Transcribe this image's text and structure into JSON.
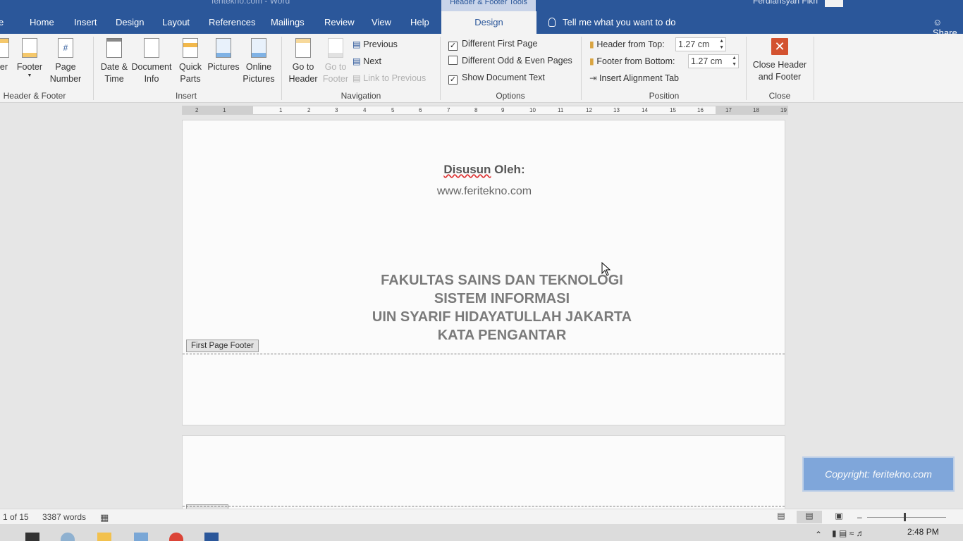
{
  "titlebar": {
    "doc_title": "feritekno.com  -  Word",
    "context_label": "Header & Footer Tools",
    "user": "Ferdiansyah Fikri",
    "tabs": [
      "Home",
      "Insert",
      "Design",
      "Layout",
      "References",
      "Mailings",
      "Review",
      "View",
      "Help"
    ],
    "active_tab": "Design",
    "tell_me": "Tell me what you want to do",
    "share": "Share"
  },
  "ribbon": {
    "header_footer": {
      "label": "Header & Footer",
      "header": "Header",
      "footer": "Footer",
      "page_number": "Page Number"
    },
    "insert": {
      "label": "Insert",
      "date_time": "Date & Time",
      "document_info": "Document Info",
      "quick_parts": "Quick Parts",
      "pictures": "Pictures",
      "online_pictures": "Online Pictures"
    },
    "navigation": {
      "label": "Navigation",
      "go_to_header": "Go to Header",
      "go_to_footer": "Go to Footer",
      "previous": "Previous",
      "next": "Next",
      "link_to_previous": "Link to Previous"
    },
    "options": {
      "label": "Options",
      "different_first_page": "Different First Page",
      "different_first_page_checked": true,
      "different_odd_even": "Different Odd & Even Pages",
      "different_odd_even_checked": false,
      "show_document_text": "Show Document Text",
      "show_document_text_checked": true
    },
    "position": {
      "label": "Position",
      "header_from_top": "Header from Top:",
      "header_from_top_value": "1.27 cm",
      "footer_from_bottom": "Footer from Bottom:",
      "footer_from_bottom_value": "1.27 cm",
      "insert_alignment_tab": "Insert Alignment Tab"
    },
    "close": {
      "label": "Close",
      "close_header_footer": "Close Header and Footer"
    }
  },
  "ruler": {
    "ticks": [
      "2",
      "1",
      "1",
      "2",
      "3",
      "4",
      "5",
      "6",
      "7",
      "8",
      "9",
      "10",
      "11",
      "12",
      "13",
      "14",
      "15",
      "16",
      "17",
      "18",
      "19"
    ]
  },
  "document": {
    "disusun_word": "Disusun",
    "oleh_word": " Oleh:",
    "website": "www.feritekno.com",
    "lines": [
      "FAKULTAS SAINS DAN TEKNOLOGI",
      "SISTEM INFORMASI",
      "UIN SYARIF HIDAYATULLAH JAKARTA",
      "KATA PENGANTAR"
    ],
    "footer_tag": "First Page Footer"
  },
  "watermark": "Copyright: feritekno.com",
  "statusbar": {
    "page": "1 of 15",
    "words": "3387 words"
  },
  "taskbar": {
    "time": "2:48 PM"
  }
}
